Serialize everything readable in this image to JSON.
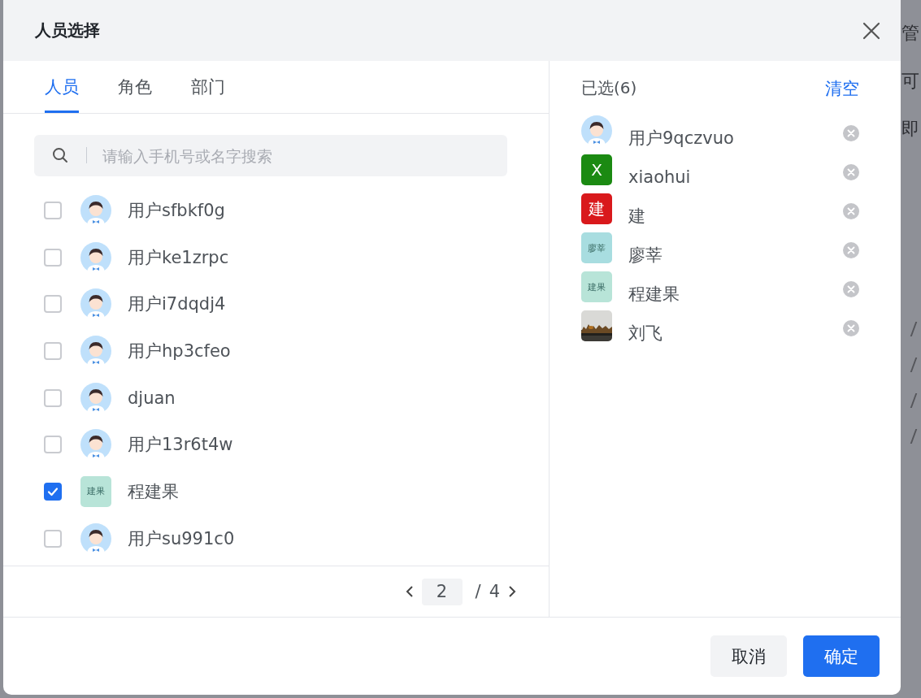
{
  "background_text": [
    "管",
    "可",
    "即"
  ],
  "dialog": {
    "title": "人员选择"
  },
  "tabs": [
    {
      "label": "人员",
      "selected": true
    },
    {
      "label": "角色",
      "selected": false
    },
    {
      "label": "部门",
      "selected": false
    }
  ],
  "search": {
    "placeholder": "请输入手机号或名字搜索"
  },
  "candidates": [
    {
      "name": "用户sfbkf0g",
      "checked": false,
      "avatar": {
        "kind": "figure"
      }
    },
    {
      "name": "用户ke1zrpc",
      "checked": false,
      "avatar": {
        "kind": "figure"
      }
    },
    {
      "name": "用户i7dqdj4",
      "checked": false,
      "avatar": {
        "kind": "figure"
      }
    },
    {
      "name": "用户hp3cfeo",
      "checked": false,
      "avatar": {
        "kind": "figure"
      }
    },
    {
      "name": "djuan",
      "checked": false,
      "avatar": {
        "kind": "figure"
      }
    },
    {
      "name": "用户13r6t4w",
      "checked": false,
      "avatar": {
        "kind": "figure"
      }
    },
    {
      "name": "程建果",
      "checked": true,
      "avatar": {
        "kind": "text",
        "text": "建果",
        "color": "#b8e4d8"
      }
    },
    {
      "name": "用户su991c0",
      "checked": false,
      "avatar": {
        "kind": "figure"
      }
    }
  ],
  "pagination": {
    "current": "2",
    "separator": "/",
    "total": "4"
  },
  "selected_panel": {
    "title": "已选(6)",
    "clear": "清空",
    "items": [
      {
        "name": "用户9qczvuo",
        "avatar": {
          "kind": "figure"
        }
      },
      {
        "name": "xiaohui",
        "avatar": {
          "kind": "text",
          "text": "X",
          "color": "#1b8a12"
        }
      },
      {
        "name": "建",
        "avatar": {
          "kind": "text",
          "text": "建",
          "color": "#d9191c"
        }
      },
      {
        "name": "廖莘",
        "avatar": {
          "kind": "text",
          "text": "廖莘",
          "color": "#a8dde0"
        }
      },
      {
        "name": "程建果",
        "avatar": {
          "kind": "text",
          "text": "建果",
          "color": "#b8e4d8"
        }
      },
      {
        "name": "刘飞"
      }
    ]
  },
  "buttons": [
    {
      "label": "取消",
      "kind": "secondary"
    },
    {
      "label": "确定",
      "kind": "primary"
    }
  ]
}
